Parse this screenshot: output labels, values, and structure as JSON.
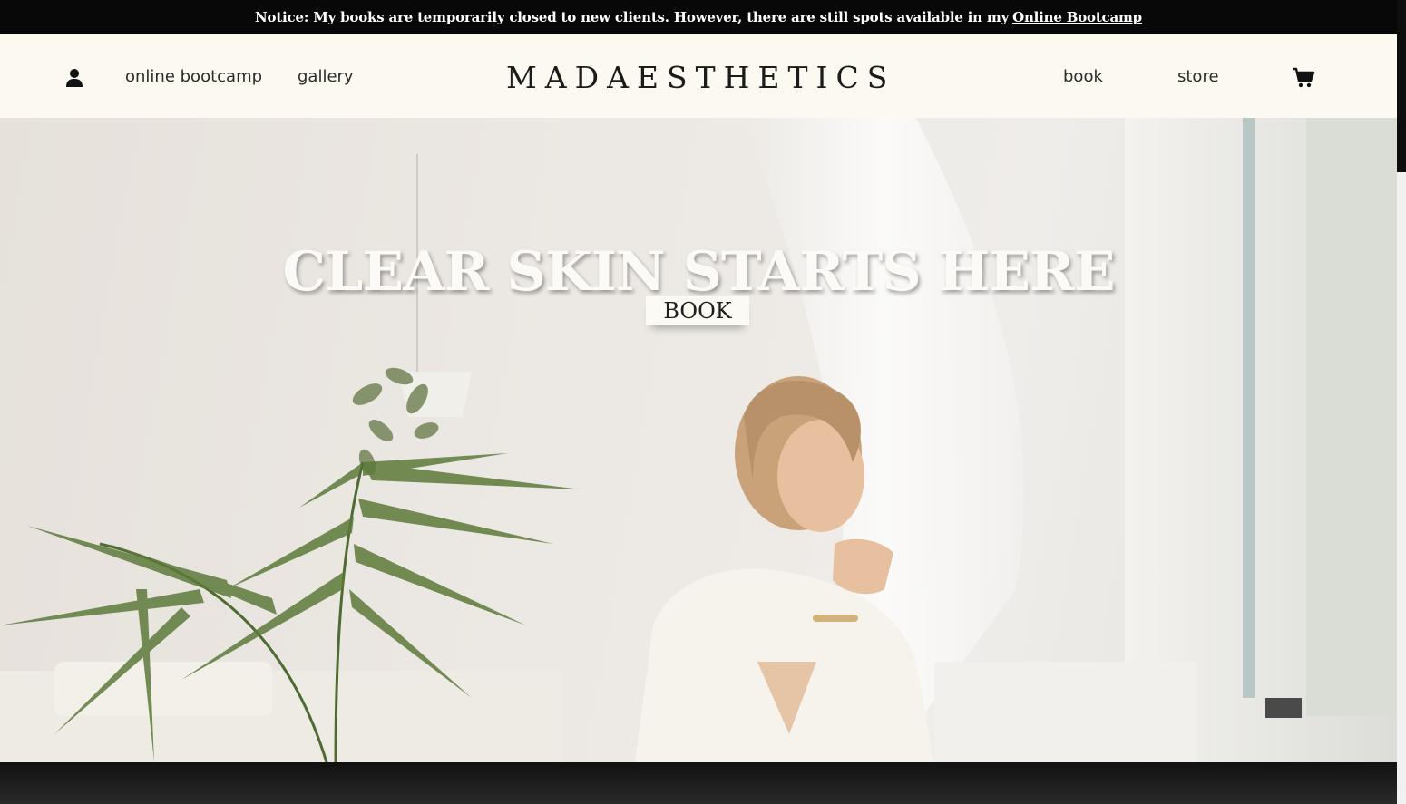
{
  "notice": {
    "text": "Notice: My books are temporarily closed to new clients. However, there are still spots available in my",
    "link_label": "Online Bootcamp"
  },
  "header": {
    "brand_left": "MAD",
    "brand_right": "AESTHETICS",
    "nav_left": [
      "online bootcamp",
      "gallery"
    ],
    "nav_right": [
      "book",
      "store"
    ],
    "icons": [
      "account-icon",
      "cart-icon"
    ]
  },
  "hero": {
    "title": "CLEAR SKIN STARTS HERE",
    "button_label": "BOOK"
  },
  "colors": {
    "notice_bg": "#080808",
    "header_bg": "#fcfaf0",
    "button_bg": "#fbfaf3",
    "footer_bg": "#151515"
  }
}
